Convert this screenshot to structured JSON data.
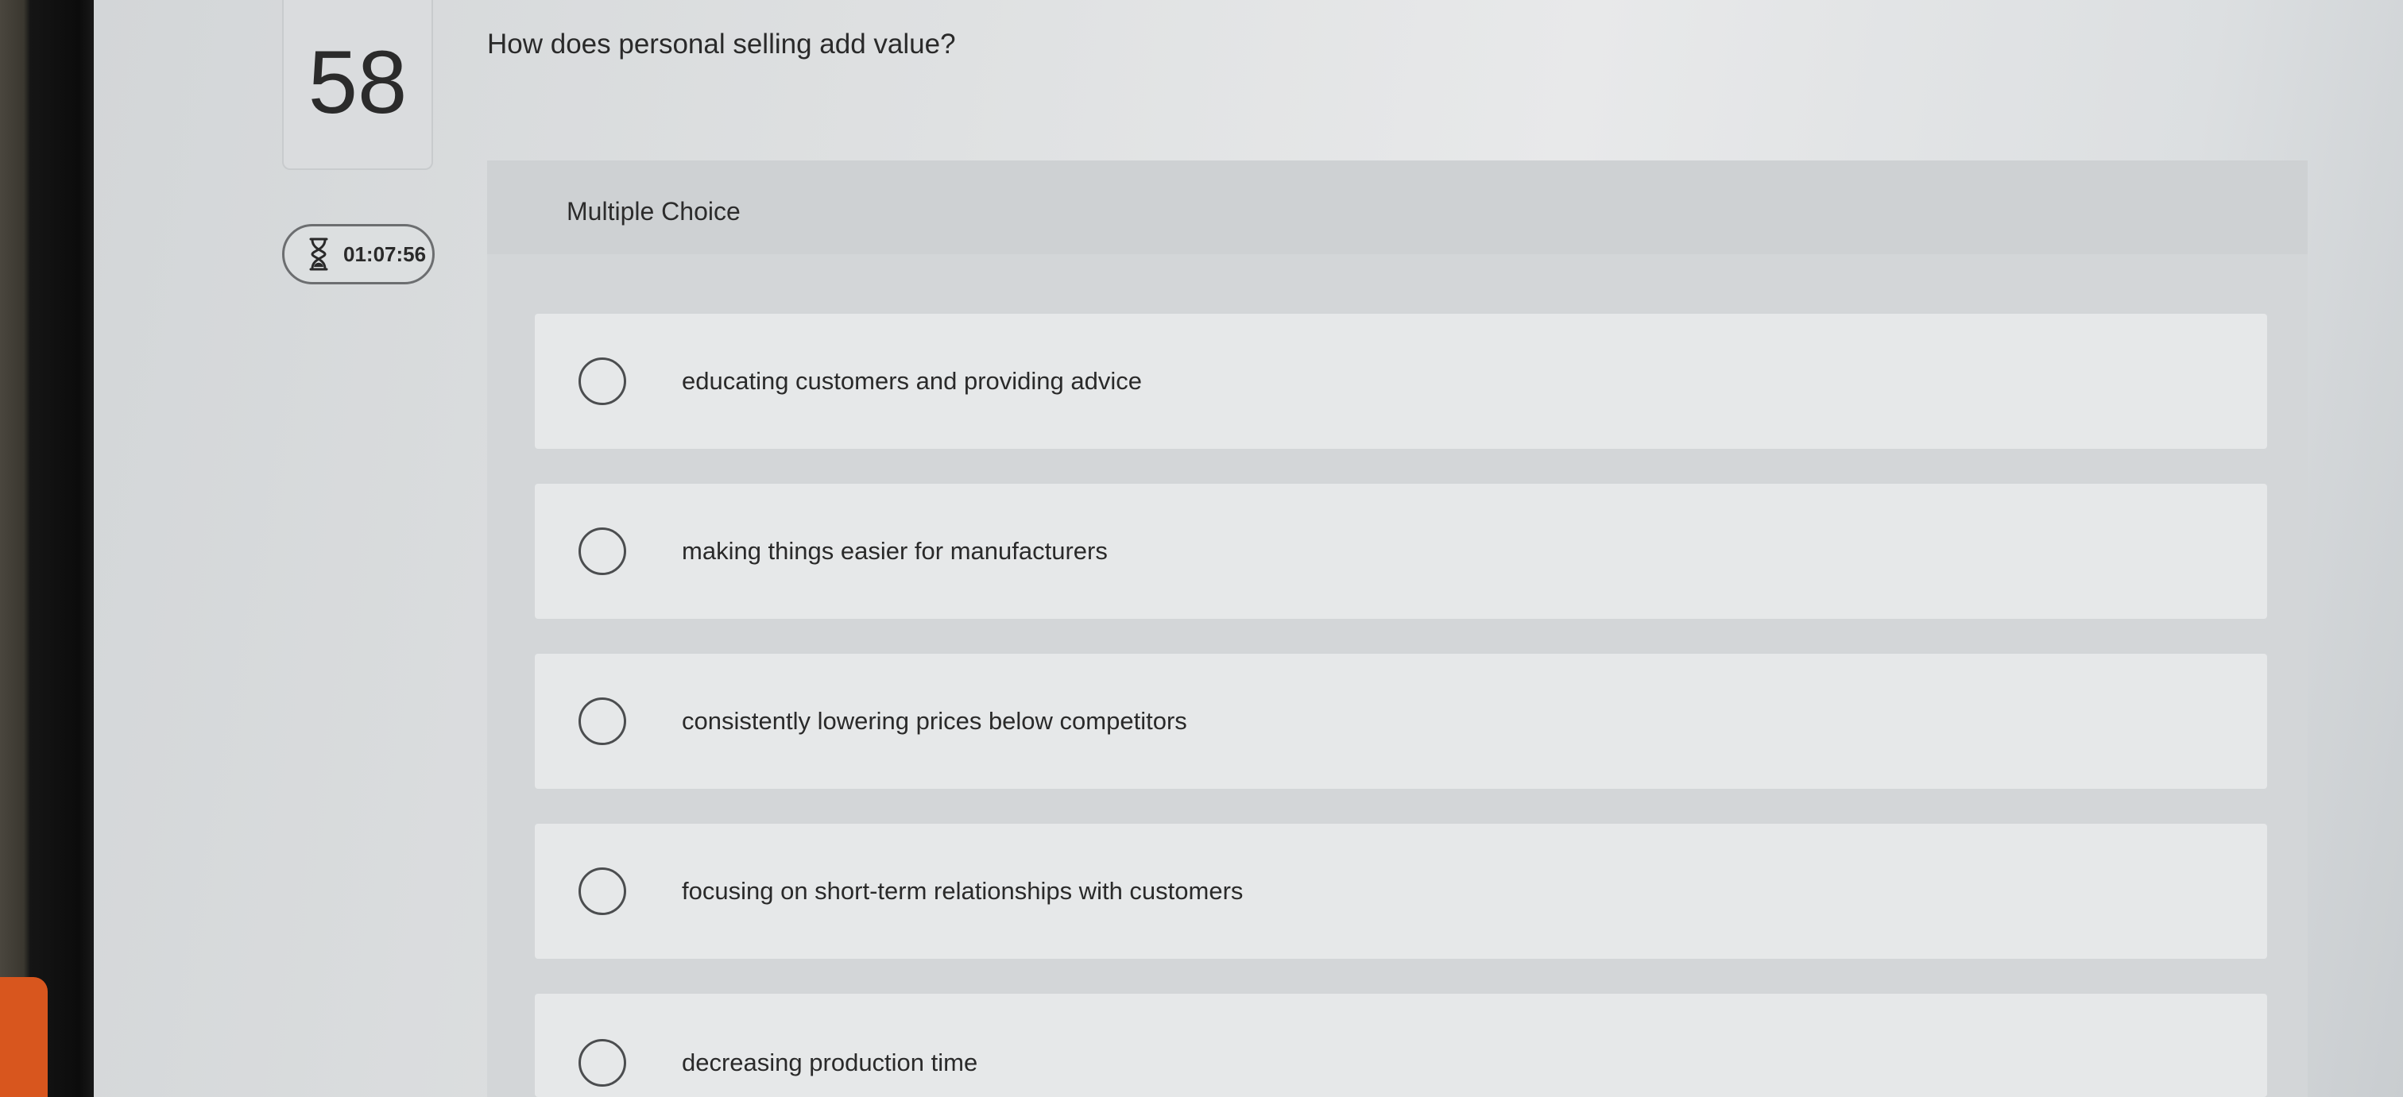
{
  "question": {
    "number": "58",
    "text": "How does personal selling add value?",
    "timer": "01:07:56"
  },
  "answers": {
    "type_label": "Multiple Choice",
    "options": [
      {
        "label": "educating customers and providing advice",
        "selected": false
      },
      {
        "label": "making things easier for manufacturers",
        "selected": false
      },
      {
        "label": "consistently lowering prices below competitors",
        "selected": false
      },
      {
        "label": "focusing on short-term relationships with customers",
        "selected": false
      },
      {
        "label": "decreasing production time",
        "selected": false
      }
    ]
  },
  "icons": {
    "timer": "hourglass-icon",
    "option": "radio-circle-icon"
  },
  "colors": {
    "background": "#dfe1e2",
    "panel": "#d3d6d8",
    "text": "#2a2a2a"
  }
}
